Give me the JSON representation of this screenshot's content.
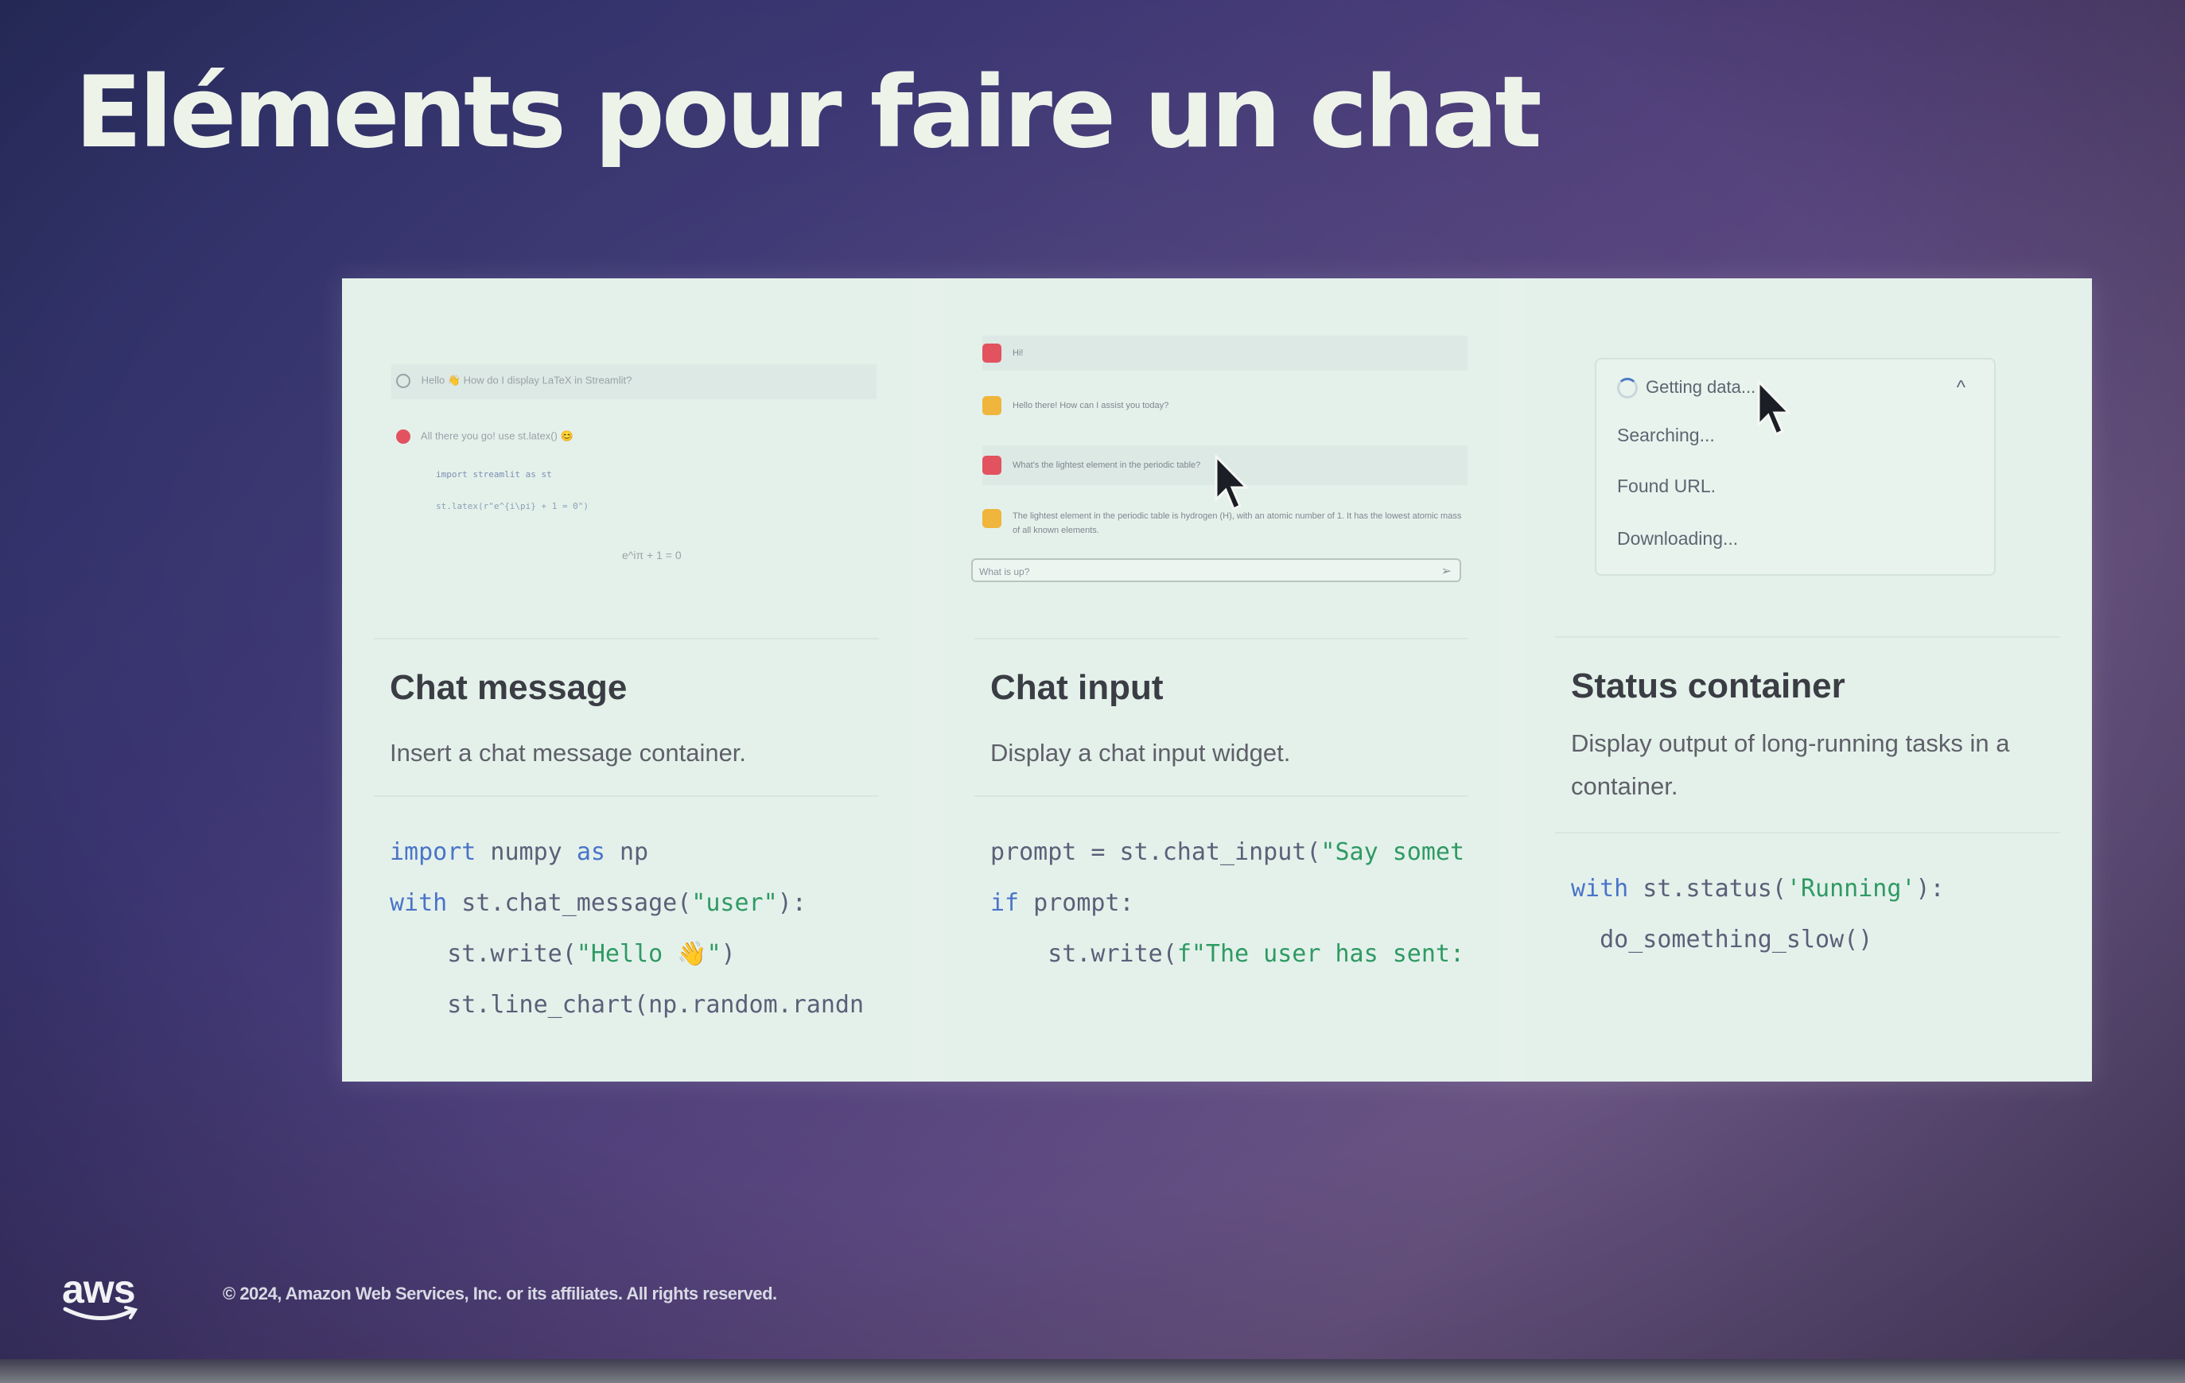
{
  "slide": {
    "title": "Eléments pour faire un chat",
    "footer": "© 2024, Amazon Web Services, Inc. or its affiliates. All rights reserved.",
    "logo": "aws"
  },
  "cards": [
    {
      "title": "Chat message",
      "description": "Insert a chat message container.",
      "preview": {
        "user_message": "Hello 👋 How do I display LaTeX in Streamlit?",
        "assistant_message": "All there you go! use st.latex() 😊",
        "code_line1": "import streamlit as st",
        "code_line2": "st.latex(r\"e^{i\\pi} + 1 = 0\")",
        "formula": "e^iπ + 1 = 0"
      }
    },
    {
      "title": "Chat input",
      "description": "Display a chat input widget.",
      "preview": {
        "msg1": "Hi!",
        "msg2": "Hello there! How can I assist you today?",
        "msg3": "What's the lightest element in the periodic table?",
        "msg4": "The lightest element in the periodic table is hydrogen (H), with an atomic number of 1. It has the lowest atomic mass of all known elements.",
        "input_placeholder": "What is up?"
      }
    },
    {
      "title": "Status container",
      "description": "Display output of long-running tasks in a container.",
      "preview": {
        "status": "Getting data...",
        "step1": "Searching...",
        "step2": "Found URL.",
        "step3": "Downloading..."
      }
    }
  ],
  "icons": {
    "user_avatar": "face-icon",
    "bot_avatar": "robot-icon",
    "send": "send-icon",
    "spinner": "spinner-icon",
    "caret": "chevron-up-icon",
    "cursor": "mouse-pointer-icon"
  },
  "colors": {
    "keyword": "#4a74c8",
    "string": "#2f9a63",
    "panel_bg": "#e6f1ec",
    "user_avatar": "#e2525f",
    "bot_avatar": "#f0b53c"
  }
}
